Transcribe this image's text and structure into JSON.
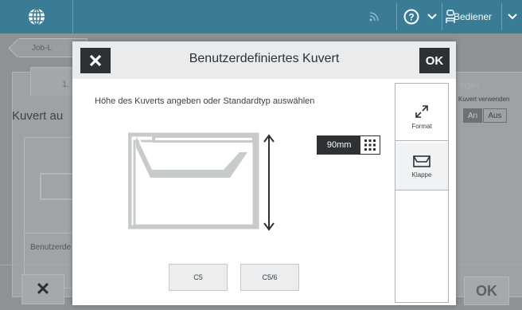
{
  "topbar": {
    "user_label": "Bediener",
    "icons": [
      "globe-icon",
      "signal-icon",
      "help-icon",
      "chevron-down-icon",
      "user-icon",
      "chevron-down-icon"
    ]
  },
  "background": {
    "back_label": "Job-L",
    "step_label": "1.",
    "section_title": "Kuvert au",
    "card_label": "Benutzerde",
    "right_label": "ingen",
    "right_small": "Kuvert verwenden",
    "toggle_on": "An",
    "toggle_off": "Aus",
    "ok_label": "OK"
  },
  "modal": {
    "title": "Benutzerdefiniertes Kuvert",
    "ok_label": "OK",
    "instruction": "Höhe des Kuverts angeben oder Standardtyp auswählen",
    "size_value": "90mm",
    "standard_types": [
      "C5",
      "C5/6"
    ],
    "tabs": [
      {
        "label": "Format",
        "icon": "resize-icon",
        "active": true
      },
      {
        "label": "Klappe",
        "icon": "envelope-flap-icon",
        "active": false
      }
    ]
  },
  "colors": {
    "topbar": "#3a7c96",
    "dark_button": "#2d3133",
    "envelope_fill": "#c8cbcc"
  }
}
